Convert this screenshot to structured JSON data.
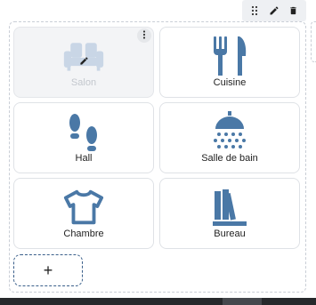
{
  "toolbar": {
    "items": [
      {
        "icon": "drag-handle-icon"
      },
      {
        "icon": "pencil-icon"
      },
      {
        "icon": "trash-icon"
      }
    ]
  },
  "tiles": [
    {
      "label": "Salon",
      "icon": "sofa-icon",
      "disabled": true
    },
    {
      "label": "Cuisine",
      "icon": "fork-knife-icon",
      "disabled": false
    },
    {
      "label": "Hall",
      "icon": "footprints-icon",
      "disabled": false
    },
    {
      "label": "Salle de bain",
      "icon": "shower-icon",
      "disabled": false
    },
    {
      "label": "Chambre",
      "icon": "tshirt-icon",
      "disabled": false
    },
    {
      "label": "Bureau",
      "icon": "books-icon",
      "disabled": false
    }
  ],
  "add_button": {
    "label": "+"
  },
  "colors": {
    "icon": "#4a78a6",
    "icon_disabled": "#c9d6e6",
    "toolbar_icon": "#333333"
  }
}
